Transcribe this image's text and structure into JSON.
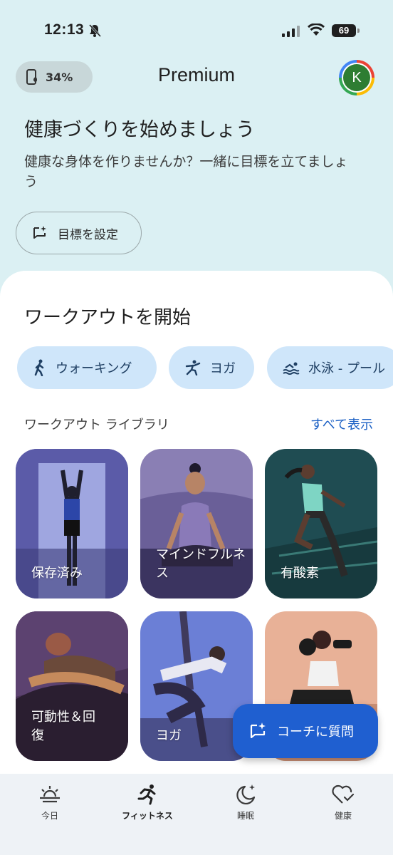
{
  "status": {
    "time": "12:13",
    "battery": "69"
  },
  "header": {
    "battery_pill": "34%",
    "title": "Premium",
    "avatar_initial": "K"
  },
  "hero": {
    "title": "健康づくりを始めましょう",
    "subtitle": "健康な身体を作りませんか？一緒に目標を立てましょう",
    "goal_button": "目標を設定"
  },
  "workout": {
    "title": "ワークアウトを開始",
    "chips": [
      "ウォーキング",
      "ヨガ",
      "水泳 - プール"
    ],
    "library_label": "ワークアウト ライブラリ",
    "see_all": "すべて表示",
    "cards": [
      "保存済み",
      "マインドフルネス",
      "有酸素",
      "可動性＆回復",
      "ヨガ",
      ""
    ]
  },
  "fab": {
    "label": "コーチに質問"
  },
  "nav": {
    "items": [
      "今日",
      "フィットネス",
      "睡眠",
      "健康"
    ]
  },
  "colors": {
    "accent": "#1f5fd0",
    "chip_bg": "#cfe6fa",
    "header_bg": "#dbf0f3"
  }
}
